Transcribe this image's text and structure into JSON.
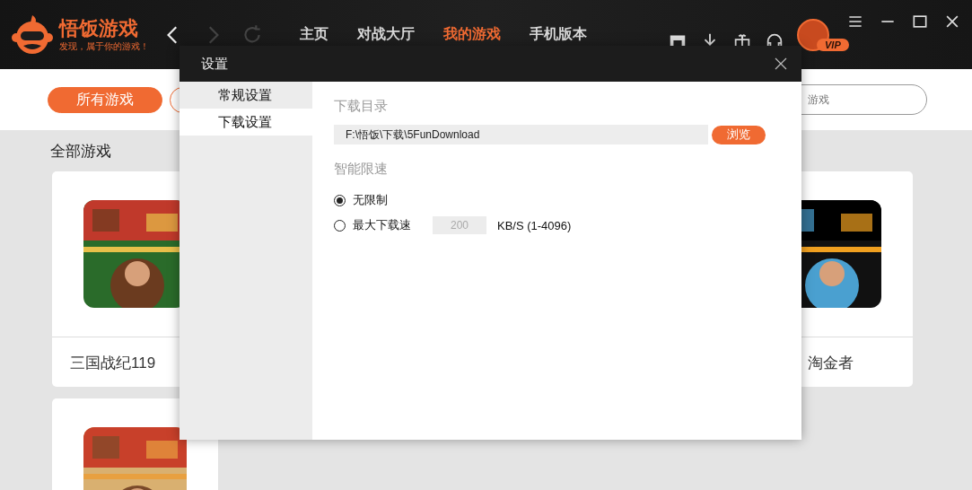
{
  "header": {
    "logo": {
      "title": "悟饭游戏",
      "slogan": "发现，属于你的游戏！"
    },
    "nav": [
      {
        "label": "主页",
        "selected": false
      },
      {
        "label": "对战大厅",
        "selected": false
      },
      {
        "label": "我的游戏",
        "selected": true
      },
      {
        "label": "手机版本",
        "selected": false
      }
    ],
    "vip_badge": "VIP"
  },
  "filters": [
    {
      "label": "所有游戏",
      "selected": true
    },
    {
      "selected": false
    }
  ],
  "search": {
    "placeholder": "游戏"
  },
  "section_title": "全部游戏",
  "games": [
    {
      "name": "三国战纪119",
      "kind": "picture"
    },
    {
      "name": "淘金者",
      "kind": "picture"
    },
    {
      "kind": "picture"
    }
  ],
  "dialog": {
    "title": "设置",
    "menu": [
      {
        "label": "常规设置",
        "selected": false
      },
      {
        "label": "下载设置",
        "selected": true
      }
    ],
    "download_dir": {
      "label": "下载目录",
      "value": "F:\\悟饭\\下载\\5FunDownload",
      "button": "浏览"
    },
    "speed": {
      "label": "智能限速",
      "options": [
        {
          "kind": "plain",
          "label": "无限制",
          "selected": true
        },
        {
          "kind": "limit",
          "label": "最大下载速",
          "value": "200",
          "disabled": true,
          "unit": "KB/S (1-4096)",
          "selected": false
        }
      ]
    }
  }
}
